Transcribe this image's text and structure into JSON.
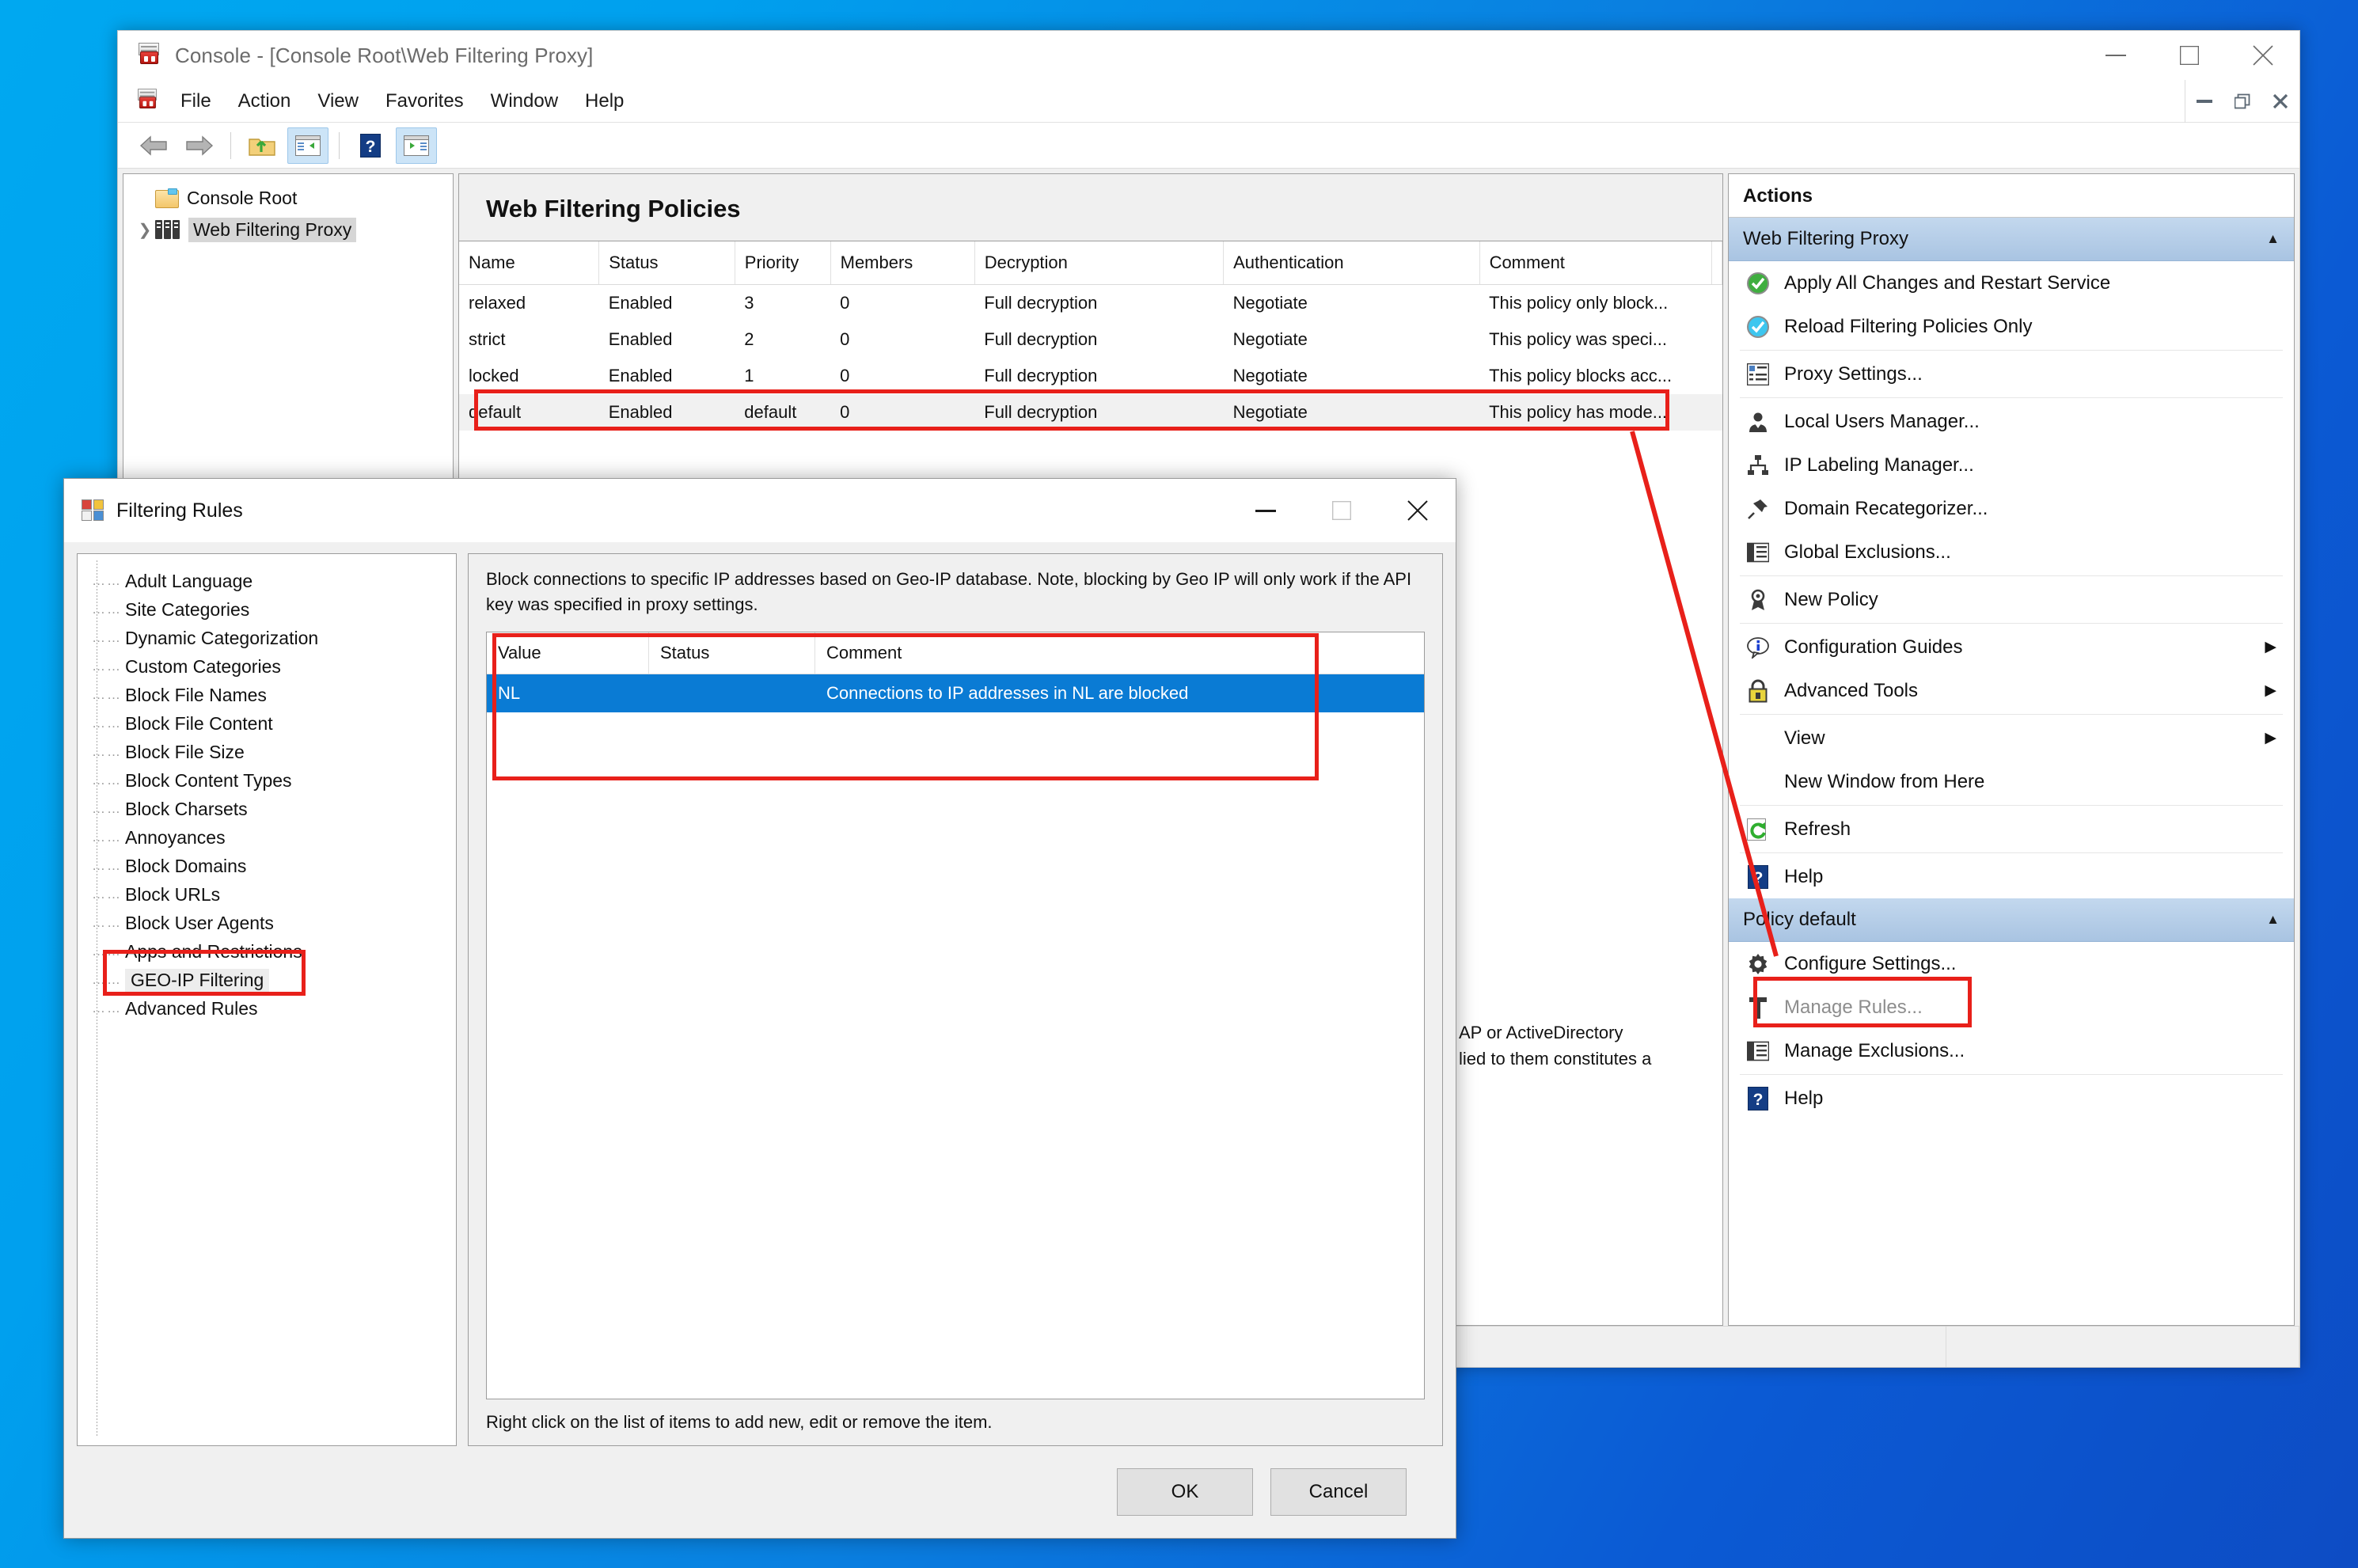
{
  "desktop": {
    "bg_from": "#00a8f0",
    "bg_to": "#0d4cc4"
  },
  "console": {
    "title": "Console - [Console Root\\Web Filtering Proxy]",
    "app_icon": "mmc-console-icon",
    "window_controls": {
      "minimize": "minimize-icon",
      "maximize": "maximize-icon",
      "close": "close-icon"
    },
    "mdi_controls": {
      "minimize": "mdi-minimize-icon",
      "restore": "mdi-restore-icon",
      "close": "mdi-close-icon"
    },
    "menu": [
      {
        "label": "File"
      },
      {
        "label": "Action"
      },
      {
        "label": "View"
      },
      {
        "label": "Favorites"
      },
      {
        "label": "Window"
      },
      {
        "label": "Help"
      }
    ],
    "toolbar": [
      {
        "name": "back-icon",
        "label": "Back",
        "active": false
      },
      {
        "name": "forward-icon",
        "label": "Forward",
        "active": false
      },
      {
        "name": "up-one-level-icon",
        "label": "Up One Level",
        "active": false
      },
      {
        "name": "show-hide-console-tree-icon",
        "label": "Show/Hide Console Tree",
        "active": true
      },
      {
        "name": "help-icon",
        "label": "Help",
        "active": false
      },
      {
        "name": "show-hide-action-pane-icon",
        "label": "Show/Hide Action Pane",
        "active": true
      }
    ],
    "tree": [
      {
        "label": "Console Root",
        "icon": "folder-icon",
        "selected": false,
        "expandable": false,
        "indent": 0
      },
      {
        "label": "Web Filtering Proxy",
        "icon": "servers-icon",
        "selected": true,
        "expandable": true,
        "indent": 1
      }
    ],
    "status_bar": {
      "cell1": "",
      "cell2": "",
      "cell3": ""
    }
  },
  "center": {
    "heading": "Web Filtering Policies",
    "columns": [
      "Name",
      "Status",
      "Priority",
      "Members",
      "Decryption",
      "Authentication",
      "Comment"
    ],
    "rows": [
      {
        "name": "relaxed",
        "status": "Enabled",
        "priority": "3",
        "members": "0",
        "decryption": "Full decryption",
        "authentication": "Negotiate",
        "comment": "This policy only block..."
      },
      {
        "name": "strict",
        "status": "Enabled",
        "priority": "2",
        "members": "0",
        "decryption": "Full decryption",
        "authentication": "Negotiate",
        "comment": "This policy was speci..."
      },
      {
        "name": "locked",
        "status": "Enabled",
        "priority": "1",
        "members": "0",
        "decryption": "Full decryption",
        "authentication": "Negotiate",
        "comment": "This policy blocks acc..."
      },
      {
        "name": "default",
        "status": "Enabled",
        "priority": "default",
        "members": "0",
        "decryption": "Full decryption",
        "authentication": "Negotiate",
        "comment": "This policy has mode..."
      }
    ],
    "obscured_text_line1": "AP or ActiveDirectory",
    "obscured_text_line2": "lied to them constitutes a"
  },
  "actions": {
    "title": "Actions",
    "groups": [
      {
        "header": "Web Filtering Proxy",
        "collapse_icon": "chevron-up-icon",
        "items": [
          {
            "label": "Apply All Changes and Restart Service",
            "icon": "green-check-icon",
            "submenu": false,
            "disabled": false,
            "sep_after": false
          },
          {
            "label": "Reload Filtering Policies Only",
            "icon": "blue-check-icon",
            "submenu": false,
            "disabled": false,
            "sep_after": true
          },
          {
            "label": "Proxy Settings...",
            "icon": "settings-list-icon",
            "submenu": false,
            "disabled": false,
            "sep_after": true
          },
          {
            "label": "Local Users Manager...",
            "icon": "user-icon",
            "submenu": false,
            "disabled": false,
            "sep_after": false
          },
          {
            "label": "IP Labeling Manager...",
            "icon": "network-tree-icon",
            "submenu": false,
            "disabled": false,
            "sep_after": false
          },
          {
            "label": "Domain Recategorizer...",
            "icon": "pushpin-icon",
            "submenu": false,
            "disabled": false,
            "sep_after": false
          },
          {
            "label": "Global Exclusions...",
            "icon": "document-list-icon",
            "submenu": false,
            "disabled": false,
            "sep_after": true
          },
          {
            "label": "New Policy",
            "icon": "ribbon-award-icon",
            "submenu": false,
            "disabled": false,
            "sep_after": true
          },
          {
            "label": "Configuration Guides",
            "icon": "info-bubble-icon",
            "submenu": true,
            "disabled": false,
            "sep_after": false
          },
          {
            "label": "Advanced Tools",
            "icon": "lock-icon",
            "submenu": true,
            "disabled": false,
            "sep_after": true
          },
          {
            "label": "View",
            "icon": "",
            "submenu": true,
            "disabled": false,
            "sep_after": false
          },
          {
            "label": "New Window from Here",
            "icon": "",
            "submenu": false,
            "disabled": false,
            "sep_after": true
          },
          {
            "label": "Refresh",
            "icon": "refresh-icon",
            "submenu": false,
            "disabled": false,
            "sep_after": true
          },
          {
            "label": "Help",
            "icon": "help-blue-icon",
            "submenu": false,
            "disabled": false,
            "sep_after": false
          }
        ]
      },
      {
        "header": "Policy default",
        "collapse_icon": "chevron-up-icon",
        "items": [
          {
            "label": "Configure Settings...",
            "icon": "gear-icon",
            "submenu": false,
            "disabled": false,
            "sep_after": false
          },
          {
            "label": "Manage Rules...",
            "icon": "hammer-icon",
            "submenu": false,
            "disabled": true,
            "sep_after": false
          },
          {
            "label": "Manage Exclusions...",
            "icon": "document-list-icon",
            "submenu": false,
            "disabled": false,
            "sep_after": true
          },
          {
            "label": "Help",
            "icon": "help-blue-icon",
            "submenu": false,
            "disabled": false,
            "sep_after": false
          }
        ]
      }
    ]
  },
  "dialog": {
    "title": "Filtering Rules",
    "icon": "filtering-rules-icon",
    "controls": {
      "minimize": "minimize-icon",
      "maximize": "maximize-icon-disabled",
      "close": "close-icon"
    },
    "tree_items": [
      {
        "label": "Adult Language",
        "selected": false
      },
      {
        "label": "Site Categories",
        "selected": false
      },
      {
        "label": "Dynamic Categorization",
        "selected": false
      },
      {
        "label": "Custom Categories",
        "selected": false
      },
      {
        "label": "Block File Names",
        "selected": false
      },
      {
        "label": "Block File Content",
        "selected": false
      },
      {
        "label": "Block File Size",
        "selected": false
      },
      {
        "label": "Block Content Types",
        "selected": false
      },
      {
        "label": "Block Charsets",
        "selected": false
      },
      {
        "label": "Annoyances",
        "selected": false
      },
      {
        "label": "Block Domains",
        "selected": false
      },
      {
        "label": "Block URLs",
        "selected": false
      },
      {
        "label": "Block User Agents",
        "selected": false
      },
      {
        "label": "Apps and Restrictions",
        "selected": false
      },
      {
        "label": "GEO-IP Filtering",
        "selected": true
      },
      {
        "label": "Advanced Rules",
        "selected": false
      }
    ],
    "description": "Block connections to specific IP addresses based on Geo-IP database. Note, blocking by Geo IP will only work if the API key was specified in proxy settings.",
    "list_columns": [
      "Value",
      "Status",
      "Comment"
    ],
    "list_rows": [
      {
        "value": "NL",
        "status": "",
        "comment": "Connections to IP addresses in NL are blocked",
        "selected": true
      }
    ],
    "hint": "Right click on the list of items to add new, edit or remove the item.",
    "ok_label": "OK",
    "cancel_label": "Cancel"
  },
  "annotations": {
    "color": "#e8201a",
    "boxes": [
      "policy-default-row",
      "geo-ip-filtering-item",
      "geo-ip-value-list",
      "manage-rules-action"
    ],
    "arrow": "from-policy-default-row-to-configure-settings"
  }
}
